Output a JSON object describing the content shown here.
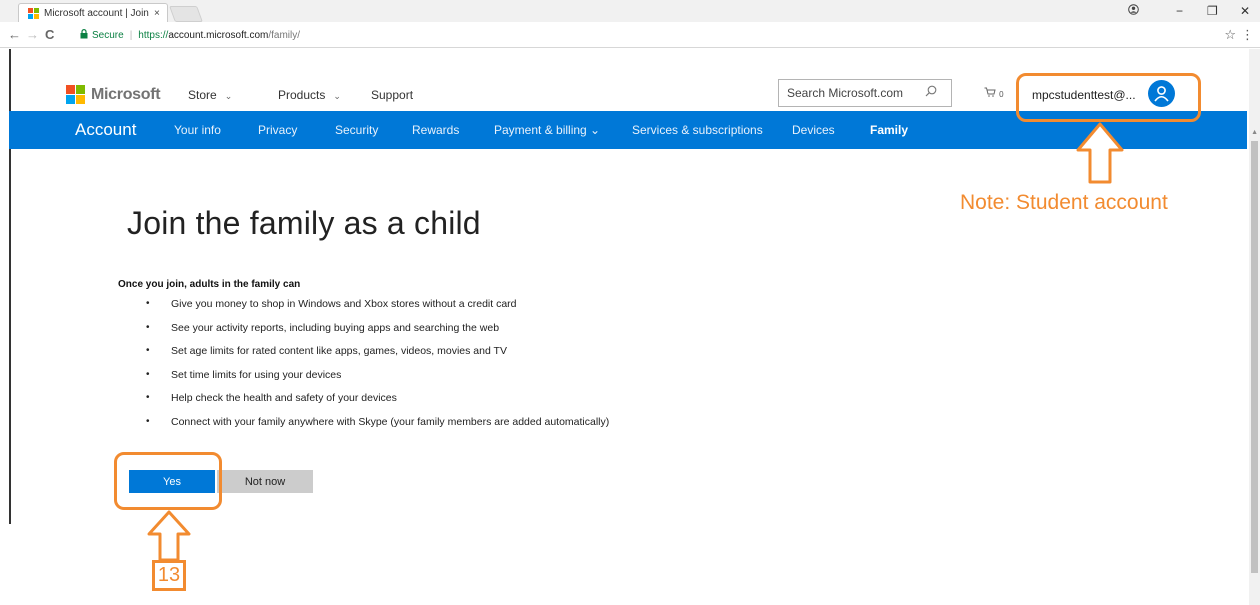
{
  "browser": {
    "tab_title": "Microsoft account | Join",
    "tab_close": "×",
    "window_controls": [
      "−",
      "❐",
      "✕"
    ],
    "profile_icon": "person-circle-icon",
    "back": "←",
    "forward": "→",
    "reload": "C",
    "secure_label": "Secure",
    "url_scheme": "https://",
    "url_host": "account.microsoft.com",
    "url_path": "/family/",
    "bookmark_star": "☆",
    "menu": "⋮"
  },
  "header": {
    "brand": "Microsoft",
    "nav": [
      {
        "label": "Store",
        "has_dropdown": true
      },
      {
        "label": "Products",
        "has_dropdown": true
      },
      {
        "label": "Support",
        "has_dropdown": false
      }
    ],
    "dropdown_glyph": "⌄",
    "search_placeholder": "Search Microsoft.com",
    "cart_glyph": "🛒",
    "cart_count": "0",
    "account_name": "mpcstudenttest@..."
  },
  "account_nav": {
    "title": "Account",
    "items": [
      {
        "label": "Your info"
      },
      {
        "label": "Privacy"
      },
      {
        "label": "Security"
      },
      {
        "label": "Rewards"
      },
      {
        "label": "Payment & billing ⌄"
      },
      {
        "label": "Services & subscriptions"
      },
      {
        "label": "Devices"
      },
      {
        "label": "Family",
        "active": true
      }
    ]
  },
  "content": {
    "heading": "Join the family as a child",
    "subheading": "Once you join, adults in the family can",
    "bullet_glyph": "•",
    "bullets": [
      "Give you money to shop in Windows and Xbox stores without a credit card",
      "See your activity reports, including buying apps and searching the web",
      "Set age limits for rated content like apps, games, videos, movies and TV",
      "Set time limits for using your devices",
      "Help check the health and safety of your devices",
      "Connect with your family anywhere with Skype (your family members are added automatically)"
    ],
    "yes_button": "Yes",
    "not_now_button": "Not now"
  },
  "annotations": {
    "note": "Note: Student account",
    "step": "13",
    "color": "#f28b30"
  },
  "colors": {
    "accent_blue": "#0078d7",
    "ms_red": "#f25022",
    "ms_green": "#7fba00",
    "ms_blue": "#00a4ef",
    "ms_yellow": "#ffb900"
  }
}
